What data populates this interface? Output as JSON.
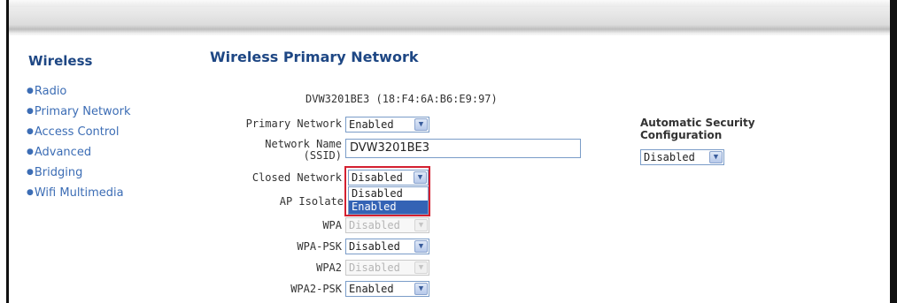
{
  "sidebar": {
    "heading": "Wireless",
    "items": [
      {
        "label": "Radio"
      },
      {
        "label": "Primary Network"
      },
      {
        "label": "Access Control"
      },
      {
        "label": "Advanced"
      },
      {
        "label": "Bridging"
      },
      {
        "label": "Wifi Multimedia"
      }
    ]
  },
  "main": {
    "title": "Wireless Primary Network",
    "device_id": "DVW3201BE3 (18:F4:6A:B6:E9:97)",
    "fields": {
      "primary_network": {
        "label": "Primary Network",
        "value": "Enabled"
      },
      "ssid": {
        "label_line1": "Network Name",
        "label_line2": "(SSID)",
        "value": "DVW3201BE3"
      },
      "closed_network": {
        "label": "Closed Network",
        "value": "Disabled",
        "options": [
          "Disabled",
          "Enabled"
        ],
        "highlighted": "Enabled"
      },
      "ap_isolate": {
        "label": "AP Isolate"
      },
      "wpa": {
        "label": "WPA",
        "value": "Disabled",
        "disabled": true
      },
      "wpa_psk": {
        "label": "WPA-PSK",
        "value": "Disabled"
      },
      "wpa2": {
        "label": "WPA2",
        "value": "Disabled",
        "disabled": true
      },
      "wpa2_psk": {
        "label": "WPA2-PSK",
        "value": "Enabled"
      }
    },
    "auto_security": {
      "label_line1": "Automatic Security",
      "label_line2": "Configuration",
      "value": "Disabled"
    }
  },
  "icons": {
    "dropdown_arrow": "chevron-down-icon",
    "bullet": "bullet-icon"
  },
  "colors": {
    "heading_blue": "#1e4784",
    "link_blue": "#3c6db5",
    "select_border": "#7a9cc8",
    "highlight": "#3463b5",
    "focus_red": "#d42030"
  }
}
